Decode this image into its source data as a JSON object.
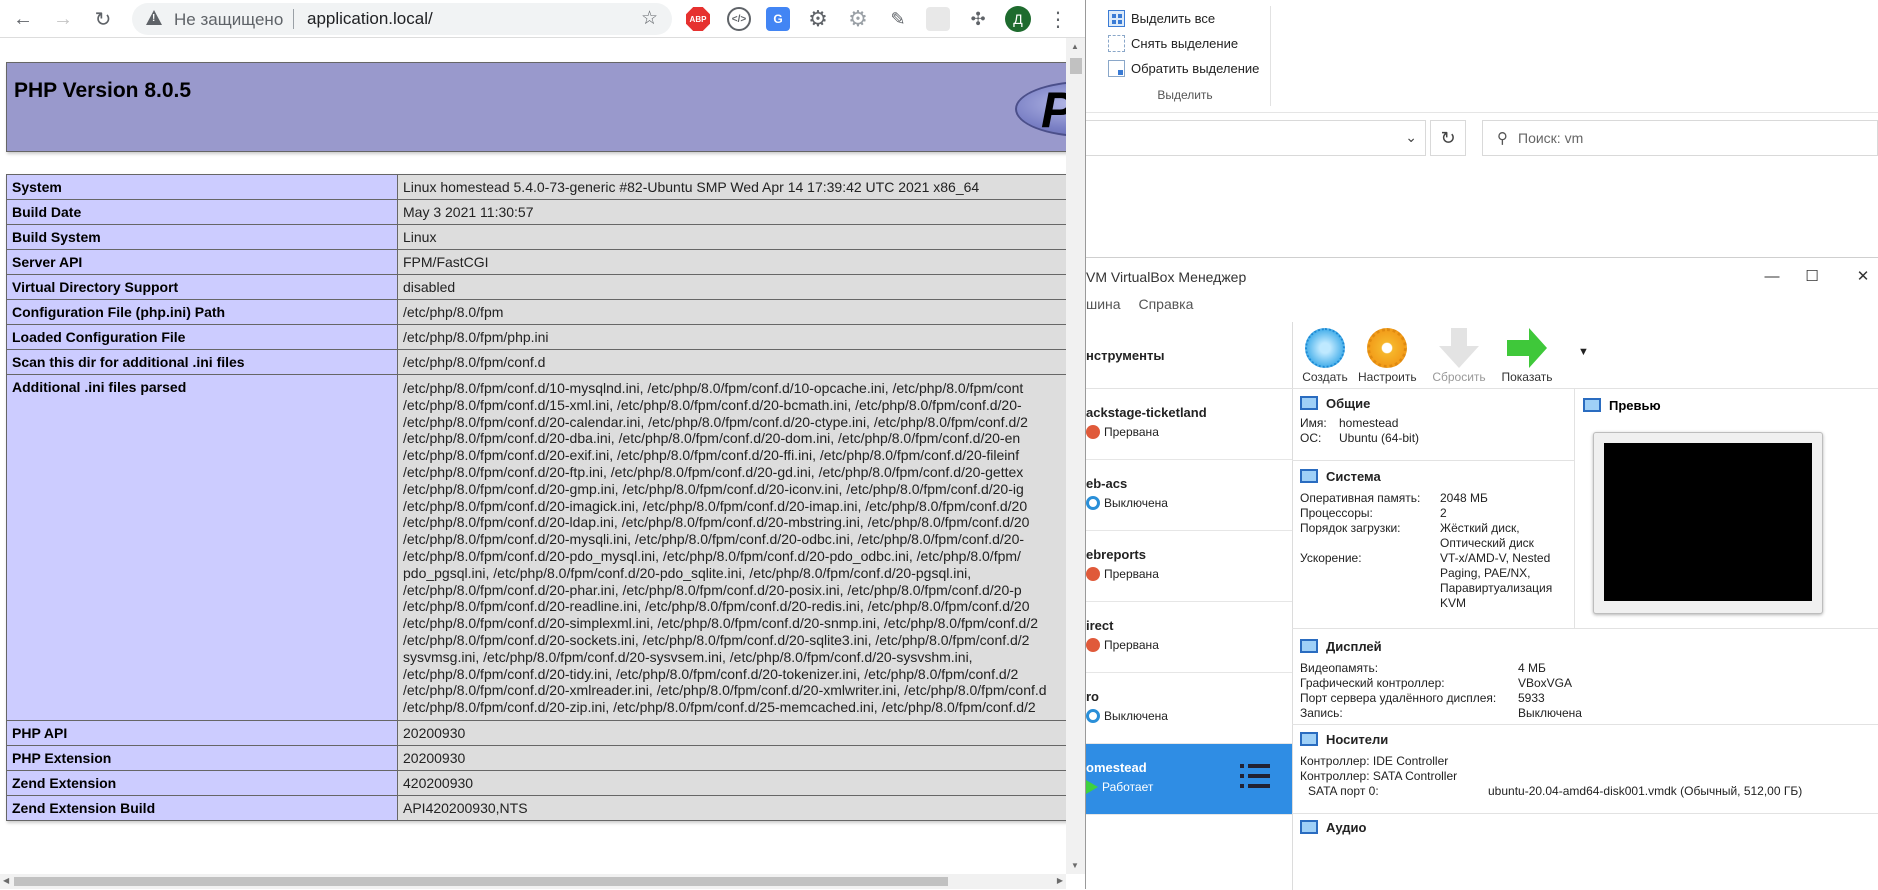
{
  "browser": {
    "omnibox": {
      "security_label": "Не защищено",
      "url": "application.local/"
    },
    "extensions": {
      "abp_label": "ABP",
      "avatar_letter": "Д"
    }
  },
  "phpinfo": {
    "title": "PHP Version 8.0.5",
    "logo_text": "P",
    "rows": [
      {
        "key": "System",
        "value": "Linux homestead 5.4.0-73-generic #82-Ubuntu SMP Wed Apr 14 17:39:42 UTC 2021 x86_64"
      },
      {
        "key": "Build Date",
        "value": "May 3 2021 11:30:57"
      },
      {
        "key": "Build System",
        "value": "Linux"
      },
      {
        "key": "Server API",
        "value": "FPM/FastCGI"
      },
      {
        "key": "Virtual Directory Support",
        "value": "disabled"
      },
      {
        "key": "Configuration File (php.ini) Path",
        "value": "/etc/php/8.0/fpm"
      },
      {
        "key": "Loaded Configuration File",
        "value": "/etc/php/8.0/fpm/php.ini"
      },
      {
        "key": "Scan this dir for additional .ini files",
        "value": "/etc/php/8.0/fpm/conf.d"
      },
      {
        "key": "Additional .ini files parsed",
        "value": "/etc/php/8.0/fpm/conf.d/10-mysqlnd.ini, /etc/php/8.0/fpm/conf.d/10-opcache.ini, /etc/php/8.0/fpm/cont\n/etc/php/8.0/fpm/conf.d/15-xml.ini, /etc/php/8.0/fpm/conf.d/20-bcmath.ini, /etc/php/8.0/fpm/conf.d/20-\n/etc/php/8.0/fpm/conf.d/20-calendar.ini, /etc/php/8.0/fpm/conf.d/20-ctype.ini, /etc/php/8.0/fpm/conf.d/2\n/etc/php/8.0/fpm/conf.d/20-dba.ini, /etc/php/8.0/fpm/conf.d/20-dom.ini, /etc/php/8.0/fpm/conf.d/20-en\n/etc/php/8.0/fpm/conf.d/20-exif.ini, /etc/php/8.0/fpm/conf.d/20-ffi.ini, /etc/php/8.0/fpm/conf.d/20-fileinf\n/etc/php/8.0/fpm/conf.d/20-ftp.ini, /etc/php/8.0/fpm/conf.d/20-gd.ini, /etc/php/8.0/fpm/conf.d/20-gettex\n/etc/php/8.0/fpm/conf.d/20-gmp.ini, /etc/php/8.0/fpm/conf.d/20-iconv.ini, /etc/php/8.0/fpm/conf.d/20-ig\n/etc/php/8.0/fpm/conf.d/20-imagick.ini, /etc/php/8.0/fpm/conf.d/20-imap.ini, /etc/php/8.0/fpm/conf.d/20\n/etc/php/8.0/fpm/conf.d/20-ldap.ini, /etc/php/8.0/fpm/conf.d/20-mbstring.ini, /etc/php/8.0/fpm/conf.d/20\n/etc/php/8.0/fpm/conf.d/20-mysqli.ini, /etc/php/8.0/fpm/conf.d/20-odbc.ini, /etc/php/8.0/fpm/conf.d/20-\n/etc/php/8.0/fpm/conf.d/20-pdo_mysql.ini, /etc/php/8.0/fpm/conf.d/20-pdo_odbc.ini, /etc/php/8.0/fpm/\npdo_pgsql.ini, /etc/php/8.0/fpm/conf.d/20-pdo_sqlite.ini, /etc/php/8.0/fpm/conf.d/20-pgsql.ini,\n/etc/php/8.0/fpm/conf.d/20-phar.ini, /etc/php/8.0/fpm/conf.d/20-posix.ini, /etc/php/8.0/fpm/conf.d/20-p\n/etc/php/8.0/fpm/conf.d/20-readline.ini, /etc/php/8.0/fpm/conf.d/20-redis.ini, /etc/php/8.0/fpm/conf.d/20\n/etc/php/8.0/fpm/conf.d/20-simplexml.ini, /etc/php/8.0/fpm/conf.d/20-snmp.ini, /etc/php/8.0/fpm/conf.d/2\n/etc/php/8.0/fpm/conf.d/20-sockets.ini, /etc/php/8.0/fpm/conf.d/20-sqlite3.ini, /etc/php/8.0/fpm/conf.d/2\nsysvmsg.ini, /etc/php/8.0/fpm/conf.d/20-sysvsem.ini, /etc/php/8.0/fpm/conf.d/20-sysvshm.ini,\n/etc/php/8.0/fpm/conf.d/20-tidy.ini, /etc/php/8.0/fpm/conf.d/20-tokenizer.ini, /etc/php/8.0/fpm/conf.d/2\n/etc/php/8.0/fpm/conf.d/20-xmlreader.ini, /etc/php/8.0/fpm/conf.d/20-xmlwriter.ini, /etc/php/8.0/fpm/conf.d\n/etc/php/8.0/fpm/conf.d/20-zip.ini, /etc/php/8.0/fpm/conf.d/25-memcached.ini, /etc/php/8.0/fpm/conf.d/2"
      },
      {
        "key": "PHP API",
        "value": "20200930"
      },
      {
        "key": "PHP Extension",
        "value": "20200930"
      },
      {
        "key": "Zend Extension",
        "value": "420200930"
      },
      {
        "key": "Zend Extension Build",
        "value": "API420200930,NTS"
      }
    ]
  },
  "explorer": {
    "ribbon": {
      "items": [
        "Выделить все",
        "Снять выделение",
        "Обратить выделение"
      ],
      "group_label": "Выделить"
    },
    "search_placeholder": "Поиск: vm"
  },
  "virtualbox": {
    "title": "VM VirtualBox Менеджер",
    "menu": [
      "шина",
      "Справка"
    ],
    "tools_label": "нструменты",
    "toolbar": [
      {
        "label": "Создать",
        "enabled": true
      },
      {
        "label": "Настроить",
        "enabled": true
      },
      {
        "label": "Сбросить",
        "enabled": false
      },
      {
        "label": "Показать",
        "enabled": true
      }
    ],
    "vms": [
      {
        "name": "ackstage-ticketland",
        "state": "Прервана",
        "state_icon": "aborted-icon"
      },
      {
        "name": "eb-acs",
        "state": "Выключена",
        "state_icon": "powered-off-icon"
      },
      {
        "name": "ebreports",
        "state": "Прервана",
        "state_icon": "aborted-icon"
      },
      {
        "name": "irect",
        "state": "Прервана",
        "state_icon": "aborted-icon"
      },
      {
        "name": "ro",
        "state": "Выключена",
        "state_icon": "powered-off-icon"
      },
      {
        "name": "omestead",
        "state": "Работает",
        "state_icon": "running-icon",
        "selected": true
      }
    ],
    "details": {
      "general": {
        "title": "Общие",
        "name_label": "Имя:",
        "name_value": "homestead",
        "os_label": "ОС:",
        "os_value": "Ubuntu (64-bit)"
      },
      "system": {
        "title": "Система",
        "ram_label": "Оперативная память:",
        "ram_value": "2048 МБ",
        "cpu_label": "Процессоры:",
        "cpu_value": "2",
        "boot_label": "Порядок загрузки:",
        "boot_value": "Жёсткий диск,\nОптический диск",
        "accel_label": "Ускорение:",
        "accel_value": "VT-x/AMD-V, Nested\nPaging, PAE/NX,\nПаравиртуализация\nKVM"
      },
      "display": {
        "title": "Дисплей",
        "vram_label": "Видеопамять:",
        "vram_value": "4 МБ",
        "gc_label": "Графический контроллер:",
        "gc_value": "VBoxVGA",
        "rdp_label": "Порт сервера удалённого дисплея:",
        "rdp_value": "5933",
        "rec_label": "Запись:",
        "rec_value": "Выключена"
      },
      "storage": {
        "title": "Носители",
        "ctrl1": "Контроллер: IDE Controller",
        "ctrl2": "Контроллер: SATA Controller",
        "port_label": "SATA порт 0:",
        "port_value": "ubuntu-20.04-amd64-disk001.vmdk (Обычный, 512,00 ГБ)"
      },
      "audio": {
        "title": "Аудио"
      },
      "preview": {
        "title": "Превью"
      }
    }
  }
}
